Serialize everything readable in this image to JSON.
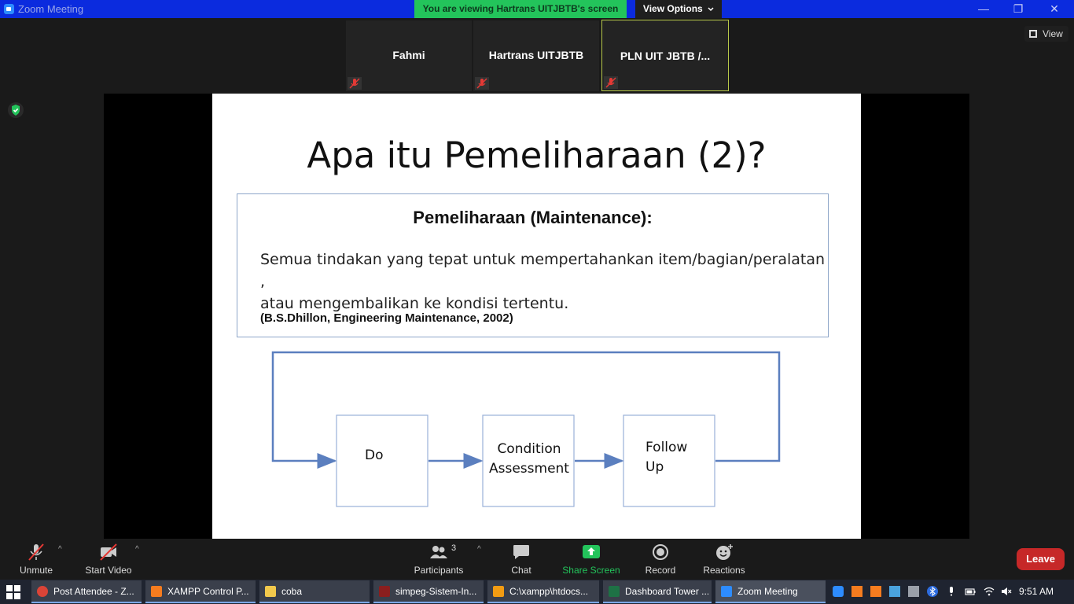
{
  "window": {
    "app_title": "Zoom Meeting",
    "banner": "You are viewing Hartrans UITJBTB's screen",
    "view_options": "View Options",
    "view_options_icon": "chevron-down-icon",
    "minimize": "—",
    "maximize": "❐",
    "close": "✕"
  },
  "participants_strip": [
    {
      "name": "Fahmi"
    },
    {
      "name": "Hartrans UITJBTB"
    },
    {
      "name": "PLN UIT JBTB /..."
    }
  ],
  "view_button": "View",
  "slide": {
    "title": "Apa itu Pemeliharaan (2)?",
    "heading": "Pemeliharaan (Maintenance):",
    "definition_line1": "Semua tindakan yang tepat untuk mempertahankan item/bagian/peralatan ,",
    "definition_line2": "atau mengembalikan ke kondisi tertentu.",
    "citation": "(B.S.Dhillon, Engineering Maintenance, 2002)",
    "diagram": {
      "node1": "Do",
      "node2_line1": "Condition",
      "node2_line2": "Assessment",
      "node3_line1": "Follow",
      "node3_line2": "Up"
    }
  },
  "toolbar": {
    "unmute": "Unmute",
    "start_video": "Start Video",
    "participants": "Participants",
    "participants_count": "3",
    "chat": "Chat",
    "share_screen": "Share Screen",
    "record": "Record",
    "reactions": "Reactions",
    "leave": "Leave"
  },
  "taskbar": {
    "tasks": [
      {
        "label": "Post Attendee - Z...",
        "color": "#db4437"
      },
      {
        "label": "XAMPP Control P...",
        "color": "#f57c1f"
      },
      {
        "label": "coba",
        "color": "#f2c94c"
      },
      {
        "label": "simpeg-Sistem-In...",
        "color": "#8b1e1e"
      },
      {
        "label": "C:\\xampp\\htdocs...",
        "color": "#f39c12"
      },
      {
        "label": "Dashboard Tower ...",
        "color": "#1e7145"
      },
      {
        "label": "Zoom Meeting",
        "color": "#2d8cff"
      }
    ],
    "time": "9:51 AM"
  },
  "colors": {
    "titlebar": "#0b2bde",
    "banner": "#23c45b",
    "share_screen_icon": "#23c45b",
    "leave": "#c62828",
    "diagram_stroke": "#5b7fbf"
  }
}
